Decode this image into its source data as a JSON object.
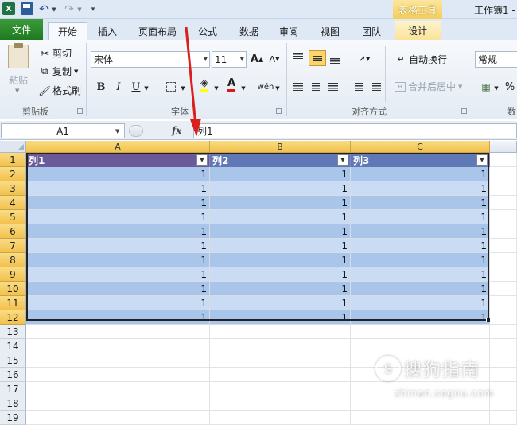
{
  "titlebar": {
    "context_label": "表格工具",
    "window_title": "工作簿1 -"
  },
  "tabs": [
    {
      "label": "文件"
    },
    {
      "label": "开始"
    },
    {
      "label": "插入"
    },
    {
      "label": "页面布局"
    },
    {
      "label": "公式"
    },
    {
      "label": "数据"
    },
    {
      "label": "审阅"
    },
    {
      "label": "视图"
    },
    {
      "label": "团队"
    },
    {
      "label": "设计"
    }
  ],
  "ribbon": {
    "clipboard": {
      "group_label": "剪贴板",
      "paste": "粘贴",
      "cut": "剪切",
      "copy": "复制",
      "format_painter": "格式刷"
    },
    "font": {
      "group_label": "字体",
      "font_name": "宋体",
      "font_size": "11",
      "bold": "B",
      "italic": "I",
      "underline": "U",
      "font_color_letter": "A",
      "grow": "A",
      "shrink": "A",
      "wen": "wén"
    },
    "alignment": {
      "group_label": "对齐方式",
      "wrap_text": "自动换行",
      "merge_center": "合并后居中"
    },
    "number": {
      "format": "常规",
      "percent": "%",
      "group_label_partial": "数"
    }
  },
  "formula_bar": {
    "name_box": "A1",
    "fx": "fx",
    "content": "列1"
  },
  "sheet": {
    "columns": [
      "A",
      "B",
      "C"
    ],
    "row_numbers": [
      "1",
      "2",
      "3",
      "4",
      "5",
      "6",
      "7",
      "8",
      "9",
      "10",
      "11",
      "12",
      "13",
      "14",
      "15",
      "16",
      "17",
      "18",
      "19"
    ],
    "table_headers": [
      "列1",
      "列2",
      "列3"
    ],
    "table_rows": [
      [
        "1",
        "1",
        "1"
      ],
      [
        "1",
        "1",
        "1"
      ],
      [
        "1",
        "1",
        "1"
      ],
      [
        "1",
        "1",
        "1"
      ],
      [
        "1",
        "1",
        "1"
      ],
      [
        "1",
        "1",
        "1"
      ],
      [
        "1",
        "1",
        "1"
      ],
      [
        "1",
        "1",
        "1"
      ],
      [
        "1",
        "1",
        "1"
      ],
      [
        "1",
        "1",
        "1"
      ],
      [
        "1",
        "1",
        "1"
      ]
    ]
  },
  "watermark": {
    "main": "搜狗指南",
    "sub": "zhinan.sogou.com"
  },
  "colors": {
    "file_tab": "#1e7a1e",
    "header_row_col1": "#6a5a9a",
    "header_row_other": "#6078b5",
    "band_dark": "#a9c6ea",
    "band_light": "#c9dcf4",
    "selected_header": "#f3c14c",
    "annotation_arrow": "#d9201c"
  }
}
